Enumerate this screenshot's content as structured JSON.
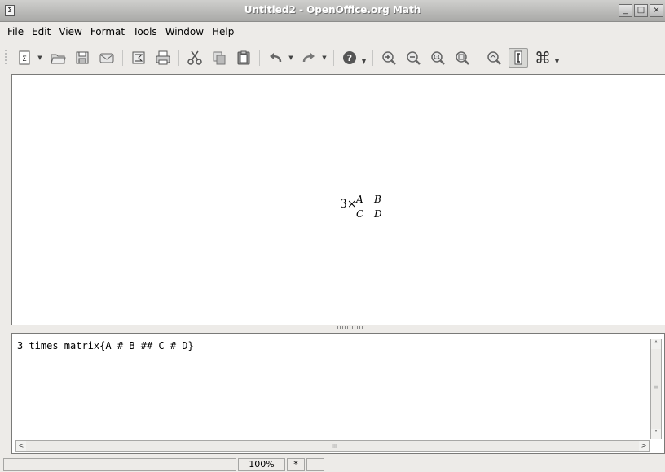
{
  "window": {
    "title": "Untitled2 - OpenOffice.org Math",
    "app_icon_glyph": "Σ",
    "controls": {
      "minimize": "_",
      "maximize": "□",
      "close": "×"
    }
  },
  "menubar": {
    "items": [
      {
        "label": "File"
      },
      {
        "label": "Edit"
      },
      {
        "label": "View"
      },
      {
        "label": "Format"
      },
      {
        "label": "Tools"
      },
      {
        "label": "Window"
      },
      {
        "label": "Help"
      }
    ]
  },
  "toolbar": {
    "buttons": [
      "formula-document-icon",
      "open-folder-icon",
      "save-icon",
      "email-icon",
      "export-pdf-icon",
      "print-icon",
      "cut-icon",
      "copy-icon",
      "paste-icon",
      "undo-icon",
      "redo-icon",
      "help-icon",
      "zoom-in-icon",
      "zoom-out-icon",
      "zoom-100-icon",
      "show-all-icon",
      "update-icon",
      "formula-cursor-icon",
      "symbols-icon"
    ],
    "formula_cursor_active": true,
    "symbols_glyph": "⌘"
  },
  "formula": {
    "prefix": "3×",
    "matrix": [
      [
        "A",
        "B"
      ],
      [
        "C",
        "D"
      ]
    ]
  },
  "commands": {
    "text": "3 times matrix{A # B ## C # D}"
  },
  "scroll": {
    "up": "˄",
    "down": "˅",
    "left": "<",
    "right": ">",
    "grip": "≡",
    "hgrip": "III"
  },
  "statusbar": {
    "zoom": "100%",
    "modified": "*"
  }
}
